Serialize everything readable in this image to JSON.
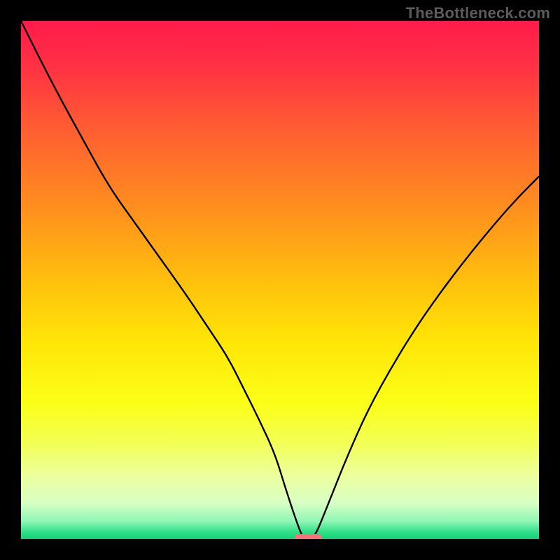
{
  "watermark": "TheBottleneck.com",
  "chart_data": {
    "type": "line",
    "title": "",
    "xlabel": "",
    "ylabel": "",
    "xlim": [
      0,
      100
    ],
    "ylim": [
      0,
      100
    ],
    "grid": false,
    "legend": false,
    "background_gradient_stops": [
      {
        "offset": 0.0,
        "color": "#ff1b4b"
      },
      {
        "offset": 0.08,
        "color": "#ff2f45"
      },
      {
        "offset": 0.2,
        "color": "#ff5a33"
      },
      {
        "offset": 0.35,
        "color": "#ff8b1f"
      },
      {
        "offset": 0.5,
        "color": "#ffbf0d"
      },
      {
        "offset": 0.62,
        "color": "#ffe607"
      },
      {
        "offset": 0.74,
        "color": "#fbff18"
      },
      {
        "offset": 0.82,
        "color": "#f2ff5a"
      },
      {
        "offset": 0.88,
        "color": "#ecffa0"
      },
      {
        "offset": 0.93,
        "color": "#d8ffc3"
      },
      {
        "offset": 0.965,
        "color": "#92f7b6"
      },
      {
        "offset": 0.985,
        "color": "#36e18b"
      },
      {
        "offset": 1.0,
        "color": "#0fd375"
      }
    ],
    "series": [
      {
        "name": "left-branch",
        "x": [
          0,
          6,
          12,
          17,
          22,
          27,
          32,
          36,
          40,
          43,
          46,
          49,
          51,
          52.8,
          54,
          54.5
        ],
        "y": [
          100,
          88,
          77,
          68,
          61,
          54,
          47,
          41,
          35,
          29,
          23,
          16.5,
          10,
          4.5,
          1.2,
          0.3
        ]
      },
      {
        "name": "right-branch",
        "x": [
          56.3,
          57,
          58,
          60,
          63,
          67,
          72,
          77,
          82,
          87,
          92,
          96,
          100
        ],
        "y": [
          0.3,
          1.2,
          3.5,
          8.5,
          16,
          25,
          34,
          42,
          49,
          55.5,
          61.5,
          66,
          70
        ]
      }
    ],
    "marker": {
      "name": "bottom-marker",
      "x_center": 55.4,
      "y_center": 0.35,
      "width": 5.2,
      "height": 1.2,
      "color": "#ff6f77"
    }
  }
}
